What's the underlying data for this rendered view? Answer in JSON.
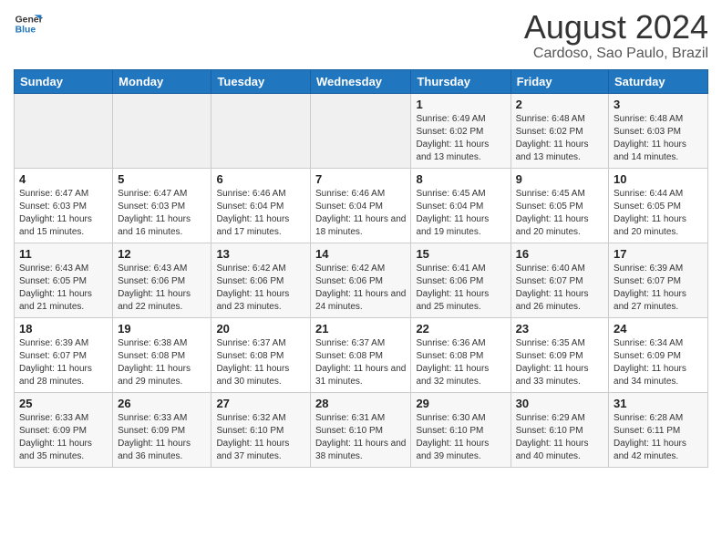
{
  "header": {
    "logo": {
      "line1": "General",
      "line2": "Blue"
    },
    "title": "August 2024",
    "subtitle": "Cardoso, Sao Paulo, Brazil"
  },
  "weekdays": [
    "Sunday",
    "Monday",
    "Tuesday",
    "Wednesday",
    "Thursday",
    "Friday",
    "Saturday"
  ],
  "weeks": [
    [
      {
        "day": "",
        "info": ""
      },
      {
        "day": "",
        "info": ""
      },
      {
        "day": "",
        "info": ""
      },
      {
        "day": "",
        "info": ""
      },
      {
        "day": "1",
        "info": "Sunrise: 6:49 AM\nSunset: 6:02 PM\nDaylight: 11 hours and 13 minutes."
      },
      {
        "day": "2",
        "info": "Sunrise: 6:48 AM\nSunset: 6:02 PM\nDaylight: 11 hours and 13 minutes."
      },
      {
        "day": "3",
        "info": "Sunrise: 6:48 AM\nSunset: 6:03 PM\nDaylight: 11 hours and 14 minutes."
      }
    ],
    [
      {
        "day": "4",
        "info": "Sunrise: 6:47 AM\nSunset: 6:03 PM\nDaylight: 11 hours and 15 minutes."
      },
      {
        "day": "5",
        "info": "Sunrise: 6:47 AM\nSunset: 6:03 PM\nDaylight: 11 hours and 16 minutes."
      },
      {
        "day": "6",
        "info": "Sunrise: 6:46 AM\nSunset: 6:04 PM\nDaylight: 11 hours and 17 minutes."
      },
      {
        "day": "7",
        "info": "Sunrise: 6:46 AM\nSunset: 6:04 PM\nDaylight: 11 hours and 18 minutes."
      },
      {
        "day": "8",
        "info": "Sunrise: 6:45 AM\nSunset: 6:04 PM\nDaylight: 11 hours and 19 minutes."
      },
      {
        "day": "9",
        "info": "Sunrise: 6:45 AM\nSunset: 6:05 PM\nDaylight: 11 hours and 20 minutes."
      },
      {
        "day": "10",
        "info": "Sunrise: 6:44 AM\nSunset: 6:05 PM\nDaylight: 11 hours and 20 minutes."
      }
    ],
    [
      {
        "day": "11",
        "info": "Sunrise: 6:43 AM\nSunset: 6:05 PM\nDaylight: 11 hours and 21 minutes."
      },
      {
        "day": "12",
        "info": "Sunrise: 6:43 AM\nSunset: 6:06 PM\nDaylight: 11 hours and 22 minutes."
      },
      {
        "day": "13",
        "info": "Sunrise: 6:42 AM\nSunset: 6:06 PM\nDaylight: 11 hours and 23 minutes."
      },
      {
        "day": "14",
        "info": "Sunrise: 6:42 AM\nSunset: 6:06 PM\nDaylight: 11 hours and 24 minutes."
      },
      {
        "day": "15",
        "info": "Sunrise: 6:41 AM\nSunset: 6:06 PM\nDaylight: 11 hours and 25 minutes."
      },
      {
        "day": "16",
        "info": "Sunrise: 6:40 AM\nSunset: 6:07 PM\nDaylight: 11 hours and 26 minutes."
      },
      {
        "day": "17",
        "info": "Sunrise: 6:39 AM\nSunset: 6:07 PM\nDaylight: 11 hours and 27 minutes."
      }
    ],
    [
      {
        "day": "18",
        "info": "Sunrise: 6:39 AM\nSunset: 6:07 PM\nDaylight: 11 hours and 28 minutes."
      },
      {
        "day": "19",
        "info": "Sunrise: 6:38 AM\nSunset: 6:08 PM\nDaylight: 11 hours and 29 minutes."
      },
      {
        "day": "20",
        "info": "Sunrise: 6:37 AM\nSunset: 6:08 PM\nDaylight: 11 hours and 30 minutes."
      },
      {
        "day": "21",
        "info": "Sunrise: 6:37 AM\nSunset: 6:08 PM\nDaylight: 11 hours and 31 minutes."
      },
      {
        "day": "22",
        "info": "Sunrise: 6:36 AM\nSunset: 6:08 PM\nDaylight: 11 hours and 32 minutes."
      },
      {
        "day": "23",
        "info": "Sunrise: 6:35 AM\nSunset: 6:09 PM\nDaylight: 11 hours and 33 minutes."
      },
      {
        "day": "24",
        "info": "Sunrise: 6:34 AM\nSunset: 6:09 PM\nDaylight: 11 hours and 34 minutes."
      }
    ],
    [
      {
        "day": "25",
        "info": "Sunrise: 6:33 AM\nSunset: 6:09 PM\nDaylight: 11 hours and 35 minutes."
      },
      {
        "day": "26",
        "info": "Sunrise: 6:33 AM\nSunset: 6:09 PM\nDaylight: 11 hours and 36 minutes."
      },
      {
        "day": "27",
        "info": "Sunrise: 6:32 AM\nSunset: 6:10 PM\nDaylight: 11 hours and 37 minutes."
      },
      {
        "day": "28",
        "info": "Sunrise: 6:31 AM\nSunset: 6:10 PM\nDaylight: 11 hours and 38 minutes."
      },
      {
        "day": "29",
        "info": "Sunrise: 6:30 AM\nSunset: 6:10 PM\nDaylight: 11 hours and 39 minutes."
      },
      {
        "day": "30",
        "info": "Sunrise: 6:29 AM\nSunset: 6:10 PM\nDaylight: 11 hours and 40 minutes."
      },
      {
        "day": "31",
        "info": "Sunrise: 6:28 AM\nSunset: 6:11 PM\nDaylight: 11 hours and 42 minutes."
      }
    ]
  ]
}
